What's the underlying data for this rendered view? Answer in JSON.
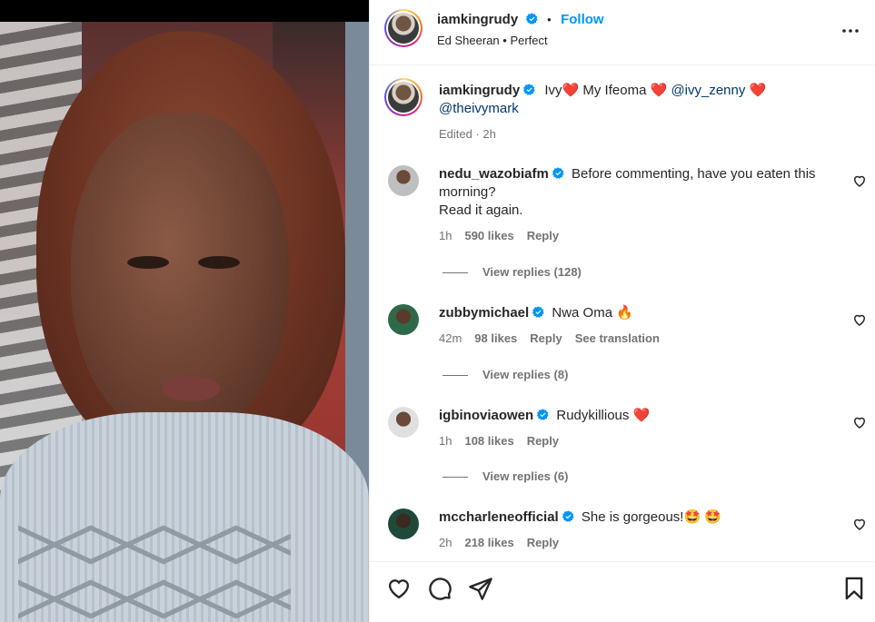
{
  "header": {
    "username": "iamkingrudy",
    "dot": "•",
    "follow_label": "Follow",
    "audio": "Ed Sheeran • Perfect"
  },
  "caption": {
    "username": "iamkingrudy",
    "text_1": "Ivy",
    "text_2": " My Ifeoma ",
    "mention_1": "@ivy_zenny",
    "mention_2": "@theivymark",
    "meta": "Edited · 2h"
  },
  "comments": [
    {
      "username": "nedu_wazobiafm",
      "text": "Before commenting, have you eaten this morning?",
      "text_line2": "Read it again.",
      "time": "1h",
      "likes": "590 likes",
      "reply": "Reply",
      "view_replies": "View replies (128)"
    },
    {
      "username": "zubbymichael",
      "text": "Nwa Oma",
      "time": "42m",
      "likes": "98 likes",
      "reply": "Reply",
      "translation": "See translation",
      "view_replies": "View replies (8)"
    },
    {
      "username": "igbinoviaowen",
      "text": "Rudykillious",
      "time": "1h",
      "likes": "108 likes",
      "reply": "Reply",
      "view_replies": "View replies (6)"
    },
    {
      "username": "mccharleneofficial",
      "text": "She is gorgeous!",
      "time": "2h",
      "likes": "218 likes",
      "reply": "Reply"
    }
  ],
  "colors": {
    "link": "#0095f6",
    "mention": "#00376b",
    "heart": "#ed4956",
    "muted": "#737373"
  },
  "icons": [
    "verified-badge-icon",
    "more-options-icon",
    "heart-outline-icon",
    "comment-icon",
    "share-icon",
    "bookmark-icon",
    "red-heart-emoji",
    "fire-emoji",
    "star-eyes-emoji"
  ]
}
